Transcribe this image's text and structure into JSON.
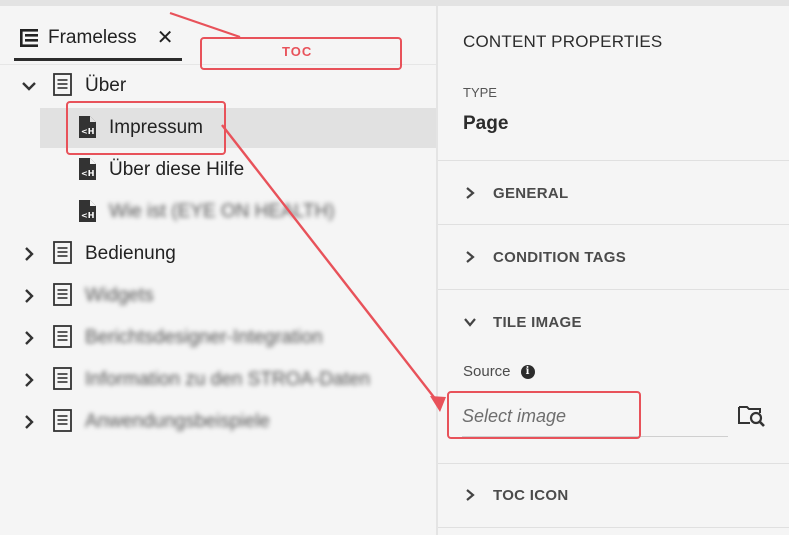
{
  "left_panel": {
    "tab": {
      "label": "Frameless",
      "close_glyph": "✕",
      "icon": "toc-icon"
    },
    "tree": [
      {
        "label": "Über",
        "level": 0,
        "expanded": true,
        "kind": "folder",
        "blurred": false
      },
      {
        "label": "Impressum",
        "level": 1,
        "kind": "topic",
        "selected": true,
        "blurred": false
      },
      {
        "label": "Über diese Hilfe",
        "level": 1,
        "kind": "topic",
        "blurred": false
      },
      {
        "label": "Wie ist (EYE ON HEALTH)",
        "level": 1,
        "kind": "topic",
        "blurred": true
      },
      {
        "label": "Bedienung",
        "level": 0,
        "expanded": false,
        "kind": "folder",
        "blurred": false
      },
      {
        "label": "Widgets",
        "level": 0,
        "expanded": false,
        "kind": "folder",
        "blurred": true
      },
      {
        "label": "Berichtsdesigner-Integration",
        "level": 0,
        "expanded": false,
        "kind": "folder",
        "blurred": true
      },
      {
        "label": "Information zu den STROA-Daten",
        "level": 0,
        "expanded": false,
        "kind": "folder",
        "blurred": true
      },
      {
        "label": "Anwendungsbeispiele",
        "level": 0,
        "expanded": false,
        "kind": "folder",
        "blurred": true
      }
    ]
  },
  "right_panel": {
    "title": "CONTENT PROPERTIES",
    "type_label": "TYPE",
    "type_value": "Page",
    "sections": {
      "general": "GENERAL",
      "condition_tags": "CONDITION TAGS",
      "tile_image": "TILE IMAGE",
      "toc_icon": "TOC ICON"
    },
    "source_label": "Source",
    "info_glyph": "i",
    "source_placeholder": "Select image"
  },
  "annotations": {
    "toc_label": "TOC",
    "color": "#e8525a"
  }
}
